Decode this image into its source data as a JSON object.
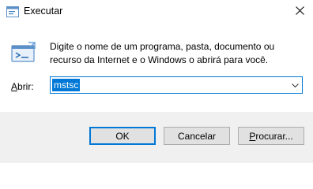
{
  "window": {
    "title": "Executar",
    "title_icon": "run-dialog-icon",
    "close_icon": "close-icon"
  },
  "body": {
    "icon": "run-icon",
    "description": "Digite o nome de um programa, pasta, documento ou recurso da Internet e o Windows o abrirá para você.",
    "open_label_accel": "A",
    "open_label_rest": "brir:",
    "input_value": "mstsc",
    "dropdown_icon": "chevron-down-icon"
  },
  "buttons": {
    "ok": "OK",
    "cancel": "Cancelar",
    "browse_accel": "P",
    "browse_rest": "rocurar..."
  },
  "colors": {
    "accent": "#0078d7",
    "footer_bg": "#f0f0f0",
    "button_bg": "#e1e1e1"
  }
}
